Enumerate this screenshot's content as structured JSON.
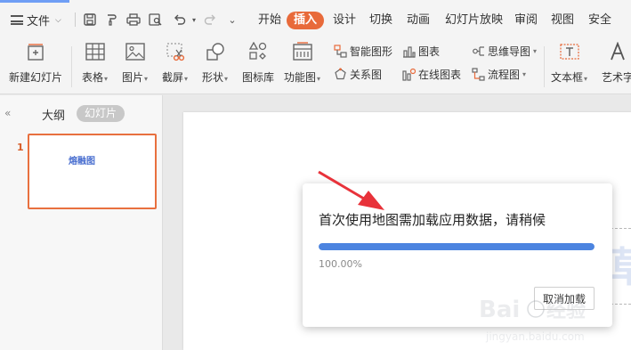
{
  "menubar": {
    "file_label": "文件",
    "quick_access": [
      "save-icon",
      "format-painter-icon",
      "print-icon",
      "print-preview-icon",
      "undo-icon",
      "redo-icon",
      "more-dropdown-icon"
    ],
    "tabs": [
      {
        "label": "开始",
        "active": false
      },
      {
        "label": "插入",
        "active": true
      },
      {
        "label": "设计",
        "active": false
      },
      {
        "label": "切换",
        "active": false
      },
      {
        "label": "动画",
        "active": false
      },
      {
        "label": "幻灯片放映",
        "active": false
      },
      {
        "label": "审阅",
        "active": false
      },
      {
        "label": "视图",
        "active": false
      },
      {
        "label": "安全",
        "active": false
      }
    ]
  },
  "ribbon": {
    "new_slide": "新建幻灯片",
    "table": "表格",
    "picture": "图片",
    "screenshot": "截屏",
    "shape": "形状",
    "icon_library": "图标库",
    "function_chart": "功能图",
    "smart_graphic": "智能图形",
    "chart": "图表",
    "relation_chart": "关系图",
    "online_chart": "在线图表",
    "mind_map": "思维导图",
    "flow_chart": "流程图",
    "text_box": "文本框",
    "art_text": "艺术字"
  },
  "left_panel": {
    "outline_tab": "大纲",
    "slides_tab": "幻灯片",
    "slide_number": "1",
    "thumb_title": "熔融图"
  },
  "dialog": {
    "message": "首次使用地图需加载应用数据，请稍候",
    "progress": 1.0,
    "percent_text": "100.00%",
    "cancel_label": "取消加载"
  },
  "colors": {
    "accent": "#e86a3a",
    "progress": "#4c84e0",
    "annotation_arrow": "#e8323a"
  },
  "watermark": {
    "brand": "Baidu经验",
    "url": "jingyan.baidu.com"
  }
}
